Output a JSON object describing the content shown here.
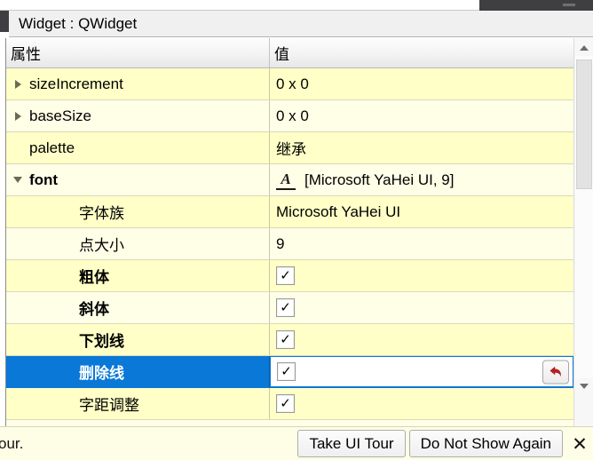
{
  "window": {
    "object_header": "Widget : QWidget"
  },
  "property_table": {
    "columns": {
      "name": "属性",
      "value": "值"
    },
    "rows": [
      {
        "name": "sizeIncrement",
        "value": "0 x 0",
        "twisty": "collapsed",
        "indent": 1,
        "bold": false,
        "type": "text",
        "selected": false,
        "shade": "a"
      },
      {
        "name": "baseSize",
        "value": "0 x 0",
        "twisty": "collapsed",
        "indent": 1,
        "bold": false,
        "type": "text",
        "selected": false,
        "shade": "b"
      },
      {
        "name": "palette",
        "value": "继承",
        "twisty": "none",
        "indent": 1,
        "bold": false,
        "type": "text",
        "selected": false,
        "shade": "a"
      },
      {
        "name": "font",
        "value": "[Microsoft YaHei UI, 9]",
        "twisty": "expanded",
        "indent": 1,
        "bold": true,
        "type": "font",
        "icon": "font-a-icon",
        "icon_glyph": "A",
        "selected": false,
        "shade": "b"
      },
      {
        "name": "字体族",
        "value": "Microsoft YaHei UI",
        "twisty": "none",
        "indent": 2,
        "bold": false,
        "type": "text",
        "selected": false,
        "shade": "a"
      },
      {
        "name": "点大小",
        "value": "9",
        "twisty": "none",
        "indent": 2,
        "bold": false,
        "type": "text",
        "selected": false,
        "shade": "b"
      },
      {
        "name": "粗体",
        "value": "✓",
        "twisty": "none",
        "indent": 2,
        "bold": true,
        "type": "checkbox",
        "checked": true,
        "selected": false,
        "shade": "a"
      },
      {
        "name": "斜体",
        "value": "✓",
        "twisty": "none",
        "indent": 2,
        "bold": true,
        "type": "checkbox",
        "checked": true,
        "selected": false,
        "shade": "b"
      },
      {
        "name": "下划线",
        "value": "✓",
        "twisty": "none",
        "indent": 2,
        "bold": true,
        "type": "checkbox",
        "checked": true,
        "selected": false,
        "shade": "a"
      },
      {
        "name": "删除线",
        "value": "✓",
        "twisty": "none",
        "indent": 2,
        "bold": true,
        "type": "checkbox",
        "checked": true,
        "selected": true,
        "shade": "b",
        "revert": "revert-icon"
      },
      {
        "name": "字距调整",
        "value": "✓",
        "twisty": "none",
        "indent": 2,
        "bold": false,
        "type": "checkbox",
        "checked": true,
        "selected": false,
        "shade": "a"
      }
    ]
  },
  "scrollbar": {
    "up_icon": "scroll-up-arrow-icon",
    "down_icon": "scroll-down-arrow-icon"
  },
  "notification": {
    "message": "our.",
    "take_tour_label": "Take UI Tour",
    "dismiss_label": "Do Not Show Again",
    "close_icon": "✕"
  },
  "colors": {
    "selection_blue": "#0a78d7",
    "row_shade_a": "#ffffc7",
    "row_shade_b": "#ffffe8",
    "notification_bg": "#fefee6",
    "revert_arrow_red": "#b42020"
  }
}
